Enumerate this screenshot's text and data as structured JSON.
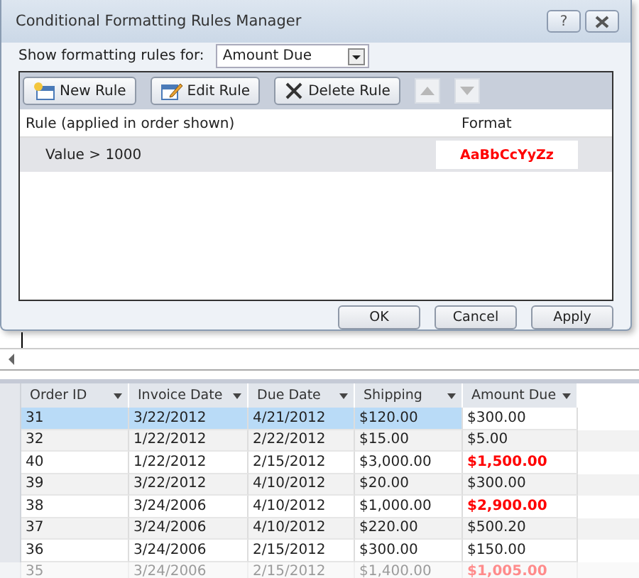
{
  "dialog": {
    "title": "Conditional Formatting Rules Manager",
    "help_button": "?",
    "show_rules_label": "Show formatting rules for:",
    "show_rules_value": "Amount Due",
    "toolbar": [
      {
        "kind": "new",
        "label": "New Rule"
      },
      {
        "kind": "edit",
        "label": "Edit Rule"
      },
      {
        "kind": "delete",
        "label": "Delete Rule"
      },
      {
        "kind": "up",
        "disabled": true
      },
      {
        "kind": "down",
        "disabled": true
      }
    ],
    "columns": [
      "Rule (applied in order shown)",
      "Format"
    ],
    "rules": [
      {
        "rule": "Value > 1000",
        "format_preview": "AaBbCcYyZz",
        "selected": true
      }
    ],
    "buttons": [
      "OK",
      "Cancel",
      "Apply"
    ]
  },
  "datasheet": {
    "columns": [
      "Order ID",
      "Invoice Date",
      "Due Date",
      "Shipping",
      "Amount Due"
    ],
    "rows": [
      {
        "cells": [
          "31",
          "3/22/2012",
          "4/21/2012",
          "$120.00",
          "$300.00"
        ],
        "selected": true,
        "highlight": false
      },
      {
        "cells": [
          "32",
          "1/22/2012",
          "2/22/2012",
          "$15.00",
          "$5.00"
        ],
        "selected": false,
        "highlight": false
      },
      {
        "cells": [
          "40",
          "1/22/2012",
          "2/15/2012",
          "$3,000.00",
          "$1,500.00"
        ],
        "selected": false,
        "highlight": true
      },
      {
        "cells": [
          "39",
          "3/22/2012",
          "4/10/2012",
          "$20.00",
          "$300.00"
        ],
        "selected": false,
        "highlight": false
      },
      {
        "cells": [
          "38",
          "3/24/2006",
          "4/10/2012",
          "$1,000.00",
          "$2,900.00"
        ],
        "selected": false,
        "highlight": true
      },
      {
        "cells": [
          "37",
          "3/24/2006",
          "4/10/2012",
          "$220.00",
          "$500.20"
        ],
        "selected": false,
        "highlight": false
      },
      {
        "cells": [
          "36",
          "3/24/2006",
          "2/15/2012",
          "$300.00",
          "$150.00"
        ],
        "selected": false,
        "highlight": false
      },
      {
        "cells": [
          "35",
          "3/24/2006",
          "2/15/2012",
          "$1,400.00",
          "$1,005.00"
        ],
        "selected": false,
        "highlight": true
      }
    ]
  }
}
